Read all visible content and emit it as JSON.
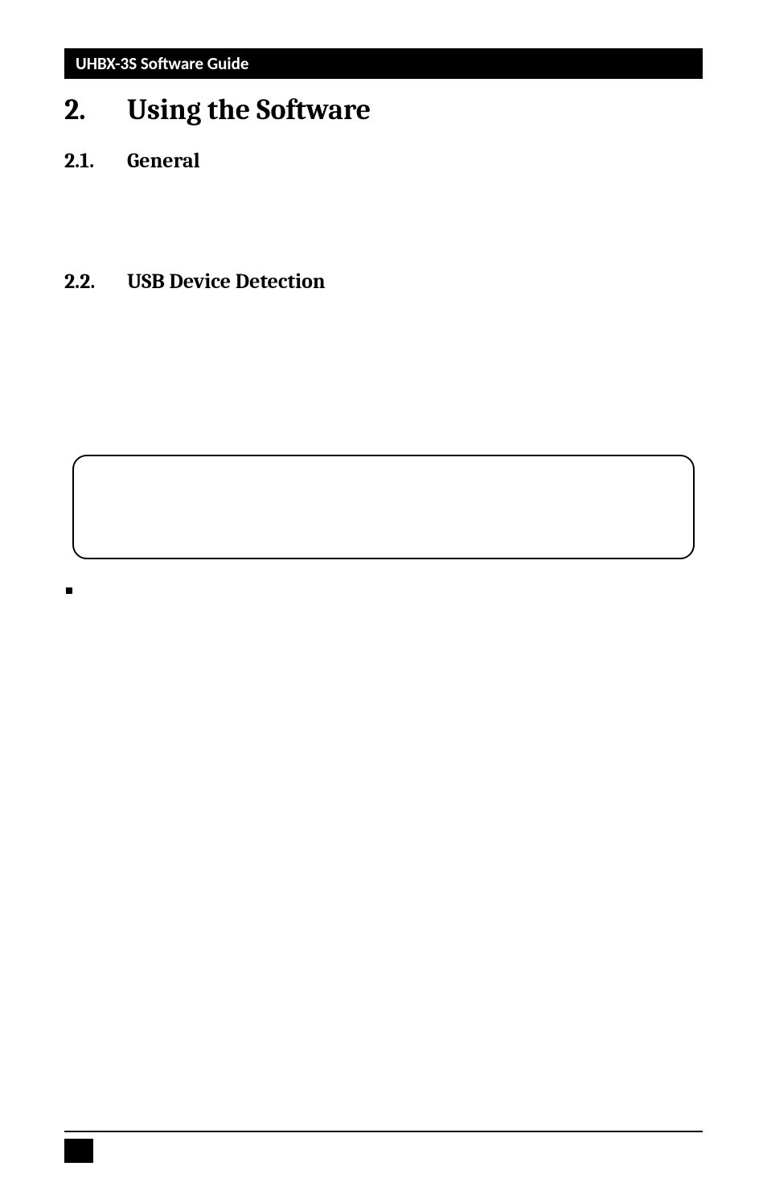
{
  "header": {
    "title": "UHBX-3S Software Guide"
  },
  "sections": {
    "chapter": {
      "number": "2.",
      "title": "Using the Software"
    },
    "sub1": {
      "number": "2.1.",
      "title": "General"
    },
    "sub2": {
      "number": "2.2.",
      "title": "USB Device Detection"
    }
  }
}
